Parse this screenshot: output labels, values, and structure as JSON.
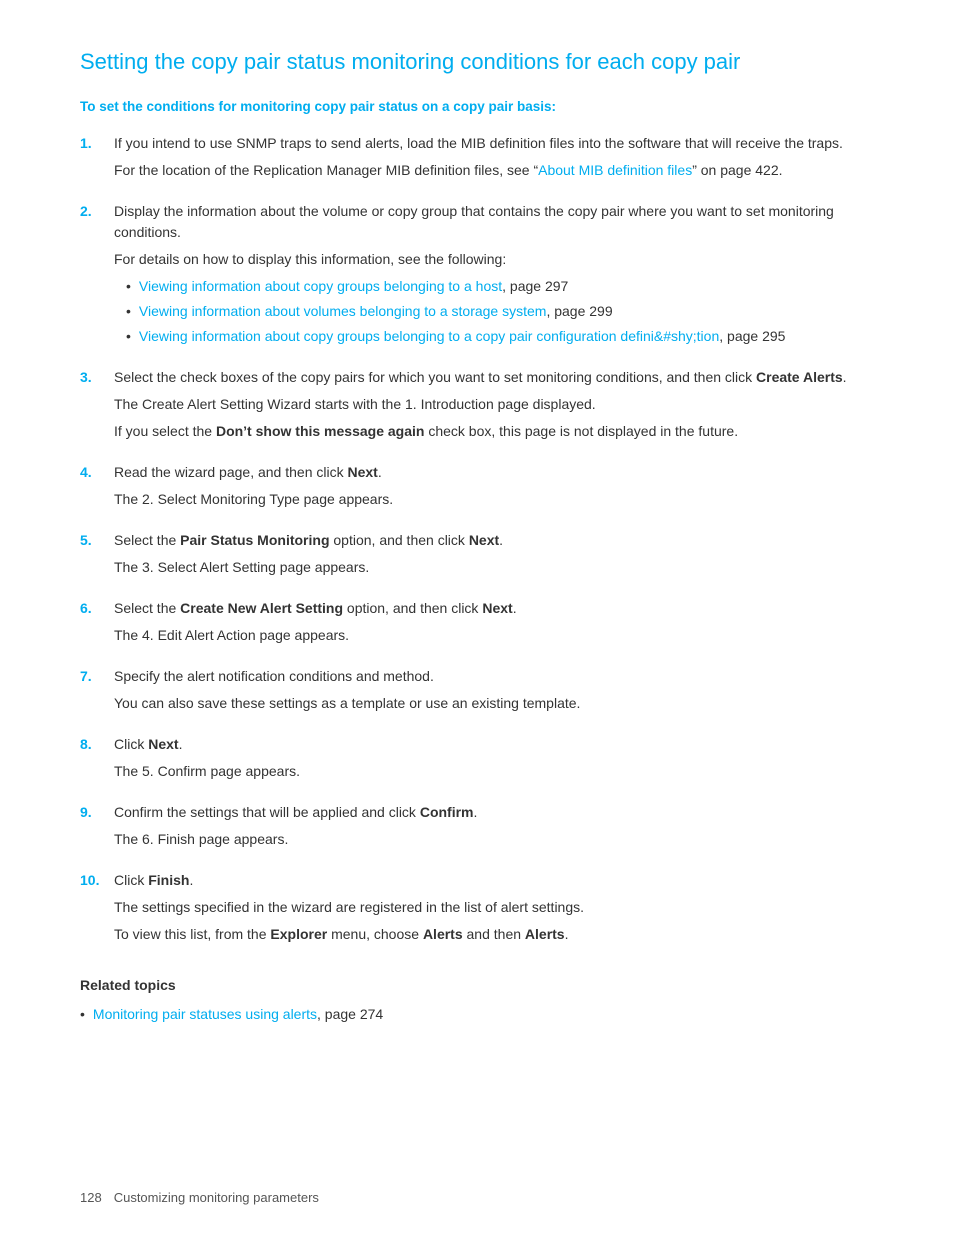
{
  "page": {
    "title": "Setting the copy pair status monitoring conditions for each copy pair",
    "subtitle": "To set the conditions for monitoring copy pair status on a copy pair basis:",
    "steps": [
      {
        "num": "1.",
        "text": "If you intend to use SNMP traps to send alerts, load the MIB definition files into the software that will receive the traps.",
        "note": "For the location of the Replication Manager MIB definition files, see “About MIB definition files” on page 422.",
        "note_link": "About MIB definition files",
        "note_link_text": "“About MIB definition files” on page 422."
      },
      {
        "num": "2.",
        "text": "Display the information about the volume or copy group that contains the copy pair where you want to set monitoring conditions.",
        "note": "For details on how to display this information, see the following:",
        "bullets": [
          {
            "link": "Viewing information about copy groups belonging to a host",
            "suffix": ", page 297"
          },
          {
            "link": "Viewing information about volumes belonging to a storage system",
            "suffix": ", page 299"
          },
          {
            "link": "Viewing information about copy groups belonging to a copy pair configuration definition",
            "suffix": ", page 295",
            "multiline": true
          }
        ]
      },
      {
        "num": "3.",
        "text_parts": [
          {
            "type": "plain",
            "text": "Select the check boxes of the copy pairs for which you want to set monitoring conditions, and then click "
          },
          {
            "type": "bold",
            "text": "Create Alerts"
          },
          {
            "type": "plain",
            "text": "."
          }
        ],
        "note": "The Create Alert Setting Wizard starts with the 1. Introduction page displayed.",
        "note2": "If you select the ",
        "note2_bold": "Don’t show this message again",
        "note2_suffix": " check box, this page is not displayed in the future."
      },
      {
        "num": "4.",
        "text_parts": [
          {
            "type": "plain",
            "text": "Read the wizard page, and then click "
          },
          {
            "type": "bold",
            "text": "Next"
          },
          {
            "type": "plain",
            "text": "."
          }
        ],
        "note": "The 2. Select Monitoring Type page appears."
      },
      {
        "num": "5.",
        "text_parts": [
          {
            "type": "plain",
            "text": "Select the "
          },
          {
            "type": "bold",
            "text": "Pair Status Monitoring"
          },
          {
            "type": "plain",
            "text": " option, and then click "
          },
          {
            "type": "bold",
            "text": "Next"
          },
          {
            "type": "plain",
            "text": "."
          }
        ],
        "note": "The 3. Select Alert Setting page appears."
      },
      {
        "num": "6.",
        "text_parts": [
          {
            "type": "plain",
            "text": "Select the "
          },
          {
            "type": "bold",
            "text": "Create New Alert Setting"
          },
          {
            "type": "plain",
            "text": " option, and then click "
          },
          {
            "type": "bold",
            "text": "Next"
          },
          {
            "type": "plain",
            "text": "."
          }
        ],
        "note": "The 4. Edit Alert Action page appears."
      },
      {
        "num": "7.",
        "text": "Specify the alert notification conditions and method.",
        "note": "You can also save these settings as a template or use an existing template."
      },
      {
        "num": "8.",
        "text_parts": [
          {
            "type": "plain",
            "text": "Click "
          },
          {
            "type": "bold",
            "text": "Next"
          },
          {
            "type": "plain",
            "text": "."
          }
        ],
        "note": "The 5. Confirm page appears."
      },
      {
        "num": "9.",
        "text_parts": [
          {
            "type": "plain",
            "text": "Confirm the settings that will be applied and click "
          },
          {
            "type": "bold",
            "text": "Confirm"
          },
          {
            "type": "plain",
            "text": "."
          }
        ],
        "note": "The 6. Finish page appears."
      },
      {
        "num": "10.",
        "text_parts": [
          {
            "type": "plain",
            "text": "Click "
          },
          {
            "type": "bold",
            "text": "Finish"
          },
          {
            "type": "plain",
            "text": "."
          }
        ],
        "note": "The settings specified in the wizard are registered in the list of alert settings.",
        "note2_plain": "To view this list, from the ",
        "note2_bold1": "Explorer",
        "note2_mid": " menu, choose ",
        "note2_bold2": "Alerts",
        "note2_and": " and then ",
        "note2_bold3": "Alerts",
        "note2_end": "."
      }
    ],
    "related_topics": {
      "heading": "Related topics",
      "items": [
        {
          "link": "Monitoring pair statuses using alerts",
          "suffix": ", page 274"
        }
      ]
    },
    "footer": {
      "page_num": "128",
      "text": "Customizing monitoring parameters"
    }
  }
}
